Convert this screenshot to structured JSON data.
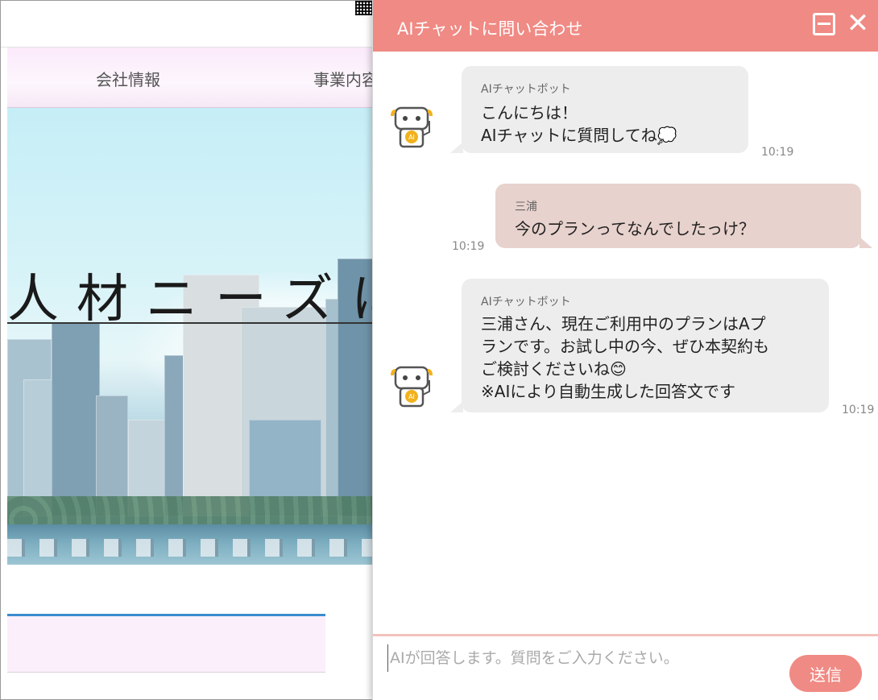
{
  "site": {
    "nav": [
      {
        "label": "会社情報"
      },
      {
        "label": "事業内容"
      }
    ],
    "hero_title": "人材ニーズに"
  },
  "chat": {
    "title": "AIチャットに問い合わせ",
    "messages": [
      {
        "role": "bot",
        "sender": "AIチャットボット",
        "text": "こんにちは！\nAIチャットに質問してね💭",
        "time": "10:19"
      },
      {
        "role": "user",
        "sender": "三浦",
        "text": "今のプランってなんでしたっけ？",
        "time": "10:19"
      },
      {
        "role": "bot",
        "sender": "AIチャットボット",
        "text": "三浦さん、現在ご利用中のプランはAプ\nランです。お試し中の今、ぜひ本契約も\nご検討くださいね😊\n※AIにより自動生成した回答文です",
        "time": "10:19"
      }
    ],
    "input": {
      "placeholder": "AIが回答します。質問をご入力ください。",
      "value": ""
    },
    "send_label": "送信",
    "colors": {
      "accent": "#f08a84",
      "bot_bubble": "#ededed",
      "user_bubble": "#e8d2cd"
    },
    "icons": {
      "minimize": "minimize-icon",
      "close": "close-icon",
      "avatar": "robot-icon"
    }
  }
}
